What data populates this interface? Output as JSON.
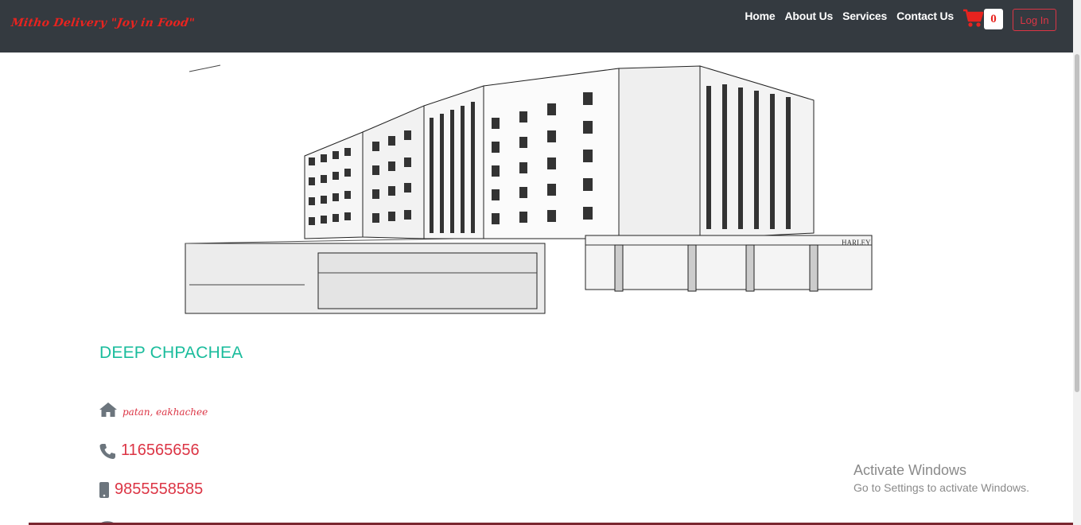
{
  "navbar": {
    "brand": "Mitho Delivery \"Joy in Food\"",
    "links": [
      "Home",
      "About Us",
      "Services",
      "Contact Us"
    ],
    "cart_count": "0",
    "login_label": "Log In"
  },
  "hotel": {
    "name": "DEEP CHPACHEA",
    "address": "patan, eakhachee",
    "phone": "116565656",
    "mobile": "9855558585"
  },
  "watermark": {
    "title": "Activate Windows",
    "subtitle": "Go to Settings to activate Windows."
  },
  "icons": {
    "cart": "shopping-cart-icon",
    "home": "home-icon",
    "phone": "phone-icon",
    "mobile": "mobile-icon"
  },
  "colors": {
    "navbar_bg": "#343a40",
    "brand": "#e8231f",
    "accent_teal": "#1abc9c",
    "accent_red": "#dc3545"
  }
}
